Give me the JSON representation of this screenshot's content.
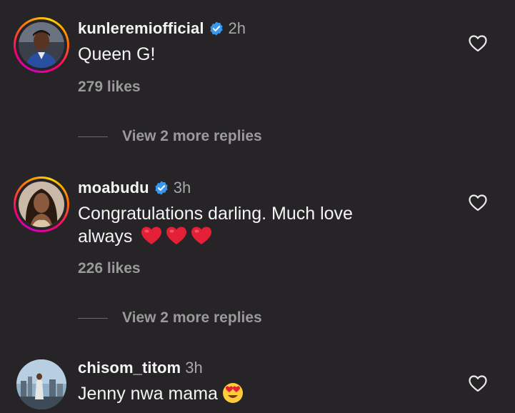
{
  "comments": [
    {
      "username": "kunleremiofficial",
      "verified": true,
      "time": "2h",
      "text": "Queen G!",
      "likes": "279 likes",
      "replies": "View 2 more replies",
      "avatar": "man-in-blue-suit-photo"
    },
    {
      "username": "moabudu",
      "verified": true,
      "time": "3h",
      "text": "Congratulations darling. Much love always",
      "text_line1": "Congratulations darling. Much love",
      "text_line2": "always",
      "emoji": "red-heart x3",
      "likes": "226 likes",
      "replies": "View 2 more replies",
      "avatar": "woman-portrait-photo"
    },
    {
      "username": "chisom_titom",
      "verified": false,
      "time": "3h",
      "text": "Jenny nwa mama",
      "emoji": "heart-eyes-face",
      "avatar": "city-skyline-photo"
    }
  ],
  "colors": {
    "background": "#262427",
    "text": "#f4f4f4",
    "muted": "#9a9a9a",
    "verified": "#3897f0",
    "heart": "#e0245e"
  },
  "icons": {
    "like": "heart-outline-icon",
    "verified": "verified-badge-icon"
  }
}
